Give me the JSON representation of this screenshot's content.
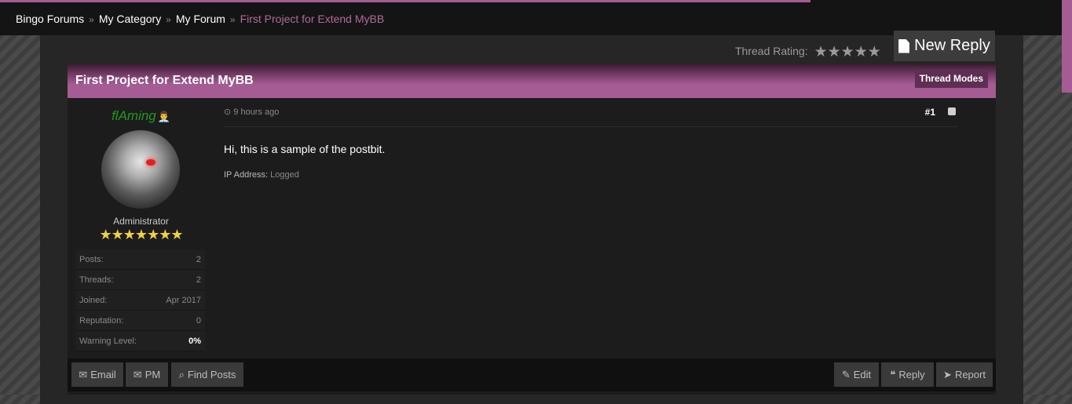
{
  "breadcrumb": {
    "items": [
      "Bingo Forums",
      "My Category",
      "My Forum"
    ],
    "current": "First Project for Extend MyBB",
    "separator": "»"
  },
  "rating": {
    "label": "Thread Rating:",
    "stars": "★★★★★",
    "value": 0
  },
  "new_reply": {
    "label": "New Reply",
    "icon": "file-icon"
  },
  "thread": {
    "title": "First Project for Extend MyBB",
    "modes_label": "Thread Modes"
  },
  "post": {
    "username": "flAming",
    "username_icon": "👨‍💼",
    "user_title": "Administrator",
    "user_stars": "★★★★★★★",
    "stats": [
      {
        "label": "Posts:",
        "value": "2"
      },
      {
        "label": "Threads:",
        "value": "2"
      },
      {
        "label": "Joined:",
        "value": "Apr 2017"
      },
      {
        "label": "Reputation:",
        "value": "0"
      },
      {
        "label": "Warning Level:",
        "value": "0%"
      }
    ],
    "time": "9 hours ago",
    "time_icon": "⊙",
    "number": "#1",
    "message": "Hi, this is a sample of the postbit.",
    "ip_label": "IP Address:",
    "ip_value": "Logged"
  },
  "buttons": {
    "email": "Email",
    "pm": "PM",
    "find_posts": "Find Posts",
    "edit": "Edit",
    "reply": "Reply",
    "report": "Report"
  },
  "colors": {
    "accent": "#a55c94",
    "username": "#1f9a1f",
    "background": "#262626"
  }
}
